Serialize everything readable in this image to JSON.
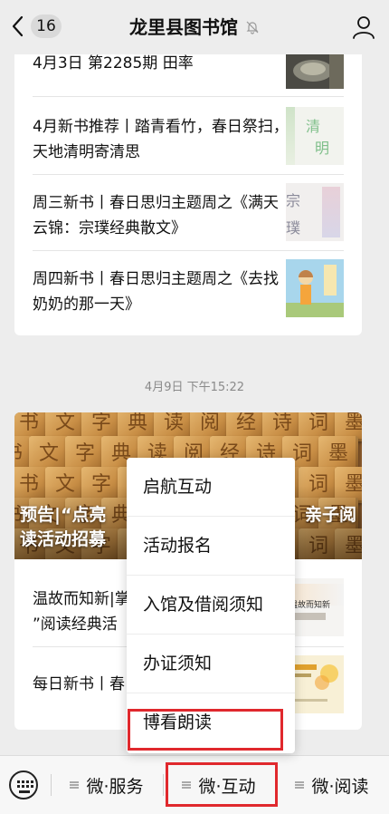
{
  "header": {
    "unread_count": "16",
    "title": "龙里县图书馆"
  },
  "feed1": {
    "articles": [
      {
        "title": "4月3日 第2285期 田率"
      },
      {
        "title": "4月新书推荐丨踏青看竹，春日祭扫，天地清明寄清思",
        "thumb_text": [
          "清",
          "明"
        ]
      },
      {
        "title": "周三新书丨春日思归主题周之《满天云锦：宗璞经典散文》",
        "thumb_text": [
          "宗",
          "璞"
        ]
      },
      {
        "title": "周四新书丨春日思归主题周之《去找奶奶的那一天》"
      }
    ]
  },
  "timestamp": "4月9日 下午15:22",
  "feed2": {
    "cover_title": "预告|“点亮……亲子阅读活动招募",
    "cover_title_left": "预告|“点亮",
    "cover_title_right": "亲子阅",
    "cover_title_line2": "读活动招募",
    "articles": [
      {
        "title_line1": "温故而知新|掌",
        "title_line2": "”阅读经典活",
        "thumb_caption": "温故而知新"
      },
      {
        "title_line1": "每日新书丨春"
      }
    ]
  },
  "menu": {
    "items": [
      "启航互动",
      "活动报名",
      "入馆及借阅须知",
      "办证须知",
      "博看朗读"
    ]
  },
  "bottom_tabs": [
    "微·服务",
    "微·互动",
    "微·阅读"
  ],
  "colors": {
    "highlight": "#e0282d",
    "background": "#ededed"
  }
}
